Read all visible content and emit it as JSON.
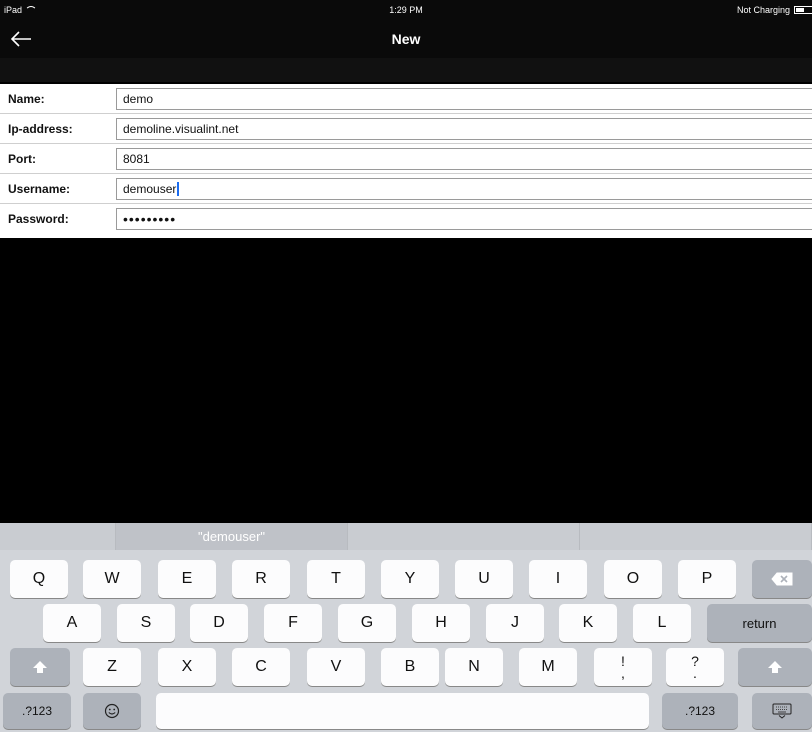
{
  "status_bar": {
    "device": "iPad",
    "time": "1:29 PM",
    "charging": "Not Charging"
  },
  "nav": {
    "title": "New",
    "back_icon": "arrow-left-icon"
  },
  "form": {
    "rows": [
      {
        "label": "Name:",
        "value": "demo"
      },
      {
        "label": "Ip-address:",
        "value": "demoline.visualint.net"
      },
      {
        "label": "Port:",
        "value": "8081"
      },
      {
        "label": "Username:",
        "value": "demouser"
      },
      {
        "label": "Password:",
        "value": "•••••••••"
      }
    ]
  },
  "keyboard": {
    "suggestion": "\"demouser\"",
    "row1": [
      "Q",
      "W",
      "E",
      "R",
      "T",
      "Y",
      "U",
      "I",
      "O",
      "P"
    ],
    "row2": [
      "A",
      "S",
      "D",
      "F",
      "G",
      "H",
      "J",
      "K",
      "L"
    ],
    "row3": [
      "Z",
      "X",
      "C",
      "V",
      "B",
      "N",
      "M"
    ],
    "return_label": "return",
    "numbers_label": ".?123",
    "punct1": [
      "!",
      ","
    ],
    "punct2": [
      "?",
      "."
    ],
    "icons": {
      "delete": "backspace-icon",
      "shift": "shift-icon",
      "emoji": "emoji-icon",
      "dismiss": "keyboard-dismiss-icon"
    }
  }
}
